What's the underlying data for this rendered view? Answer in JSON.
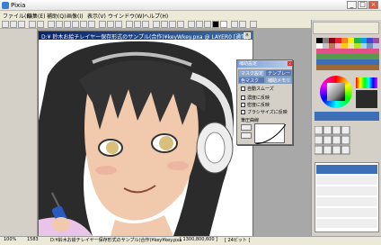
{
  "window": {
    "title": "Pixia",
    "min": "_",
    "max": "□",
    "close": "×"
  },
  "menu": [
    "ファイル(F)",
    "編集(E)",
    "補助(Q)",
    "画像(I)",
    "表示(V)",
    "ウインドウ(W)",
    "ヘルプ(H)"
  ],
  "document": {
    "title": "D:¥\t鈴木お絵チレイヤー保存形式のサンプル(合作)¥keyWkey.pxa @ LAYER0 [通常]"
  },
  "panel": {
    "title": "補助設定",
    "tabs": [
      "マスク設定",
      "テンプレート",
      "色マスク",
      "補助メモリ"
    ],
    "checks": [
      "自動スムーズ",
      "濃度に反映",
      "密度に反映",
      "ブラシサイズに反映"
    ],
    "curve_label": "筆圧曲線"
  },
  "status": {
    "zoom": "100%",
    "size": "1583",
    "path": "D:¥鈴木お絵チレイヤー保存形式のサンプル(合作)¥key¥key.pxa",
    "dims": "[ 1300,800,600 ]",
    "bits": "[ 24ビット ]"
  },
  "colors": {
    "accent": "#0a246a",
    "panel_bg": "#d4d0c8"
  }
}
